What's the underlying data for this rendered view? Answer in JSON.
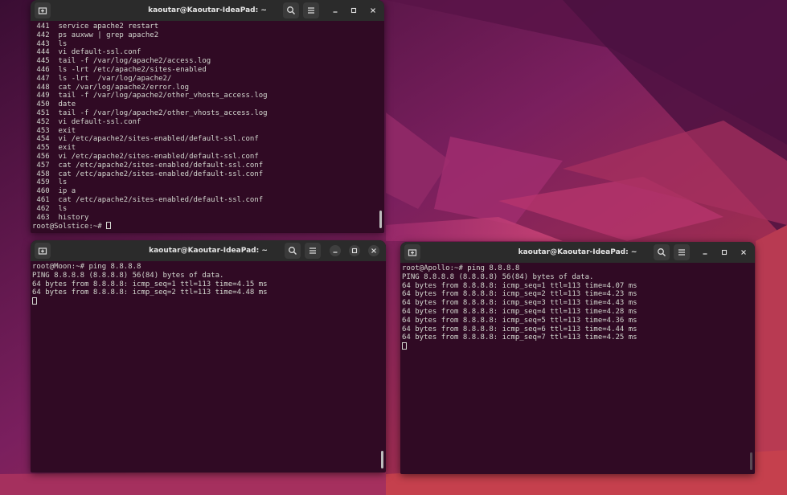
{
  "desktop": {
    "wallpaper": "ubuntu-jammy-jellyfish"
  },
  "windows": [
    {
      "id": "top-left",
      "title": "kaoutar@Kaoutar-IdeaPad: ~",
      "lines": [
        " 441  service apache2 restart",
        " 442  ps auxww | grep apache2",
        " 443  ls",
        " 444  vi default-ssl.conf",
        " 445  tail -f /var/log/apache2/access.log",
        " 446  ls -lrt /etc/apache2/sites-enabled",
        " 447  ls -lrt  /var/log/apache2/",
        " 448  cat /var/log/apache2/error.log",
        " 449  tail -f /var/log/apache2/other_vhosts_access.log",
        " 450  date",
        " 451  tail -f /var/log/apache2/other_vhosts_access.log",
        " 452  vi default-ssl.conf",
        " 453  exit",
        " 454  vi /etc/apache2/sites-enabled/default-ssl.conf",
        " 455  exit",
        " 456  vi /etc/apache2/sites-enabled/default-ssl.conf",
        " 457  cat /etc/apache2/sites-enabled/default-ssl.conf",
        " 458  cat /etc/apache2/sites-enabled/default-ssl.conf",
        " 459  ls",
        " 460  ip a",
        " 461  cat /etc/apache2/sites-enabled/default-ssl.conf",
        " 462  ls",
        " 463  history"
      ],
      "prompt": "root@Solstice:~# "
    },
    {
      "id": "bottom-left",
      "title": "kaoutar@Kaoutar-IdeaPad: ~",
      "lines": [
        "root@Moon:~# ping 8.8.8.8",
        "PING 8.8.8.8 (8.8.8.8) 56(84) bytes of data.",
        "64 bytes from 8.8.8.8: icmp_seq=1 ttl=113 time=4.15 ms",
        "64 bytes from 8.8.8.8: icmp_seq=2 ttl=113 time=4.48 ms"
      ]
    },
    {
      "id": "right",
      "title": "kaoutar@Kaoutar-IdeaPad: ~",
      "lines": [
        "root@Apollo:~# ping 8.8.8.8",
        "PING 8.8.8.8 (8.8.8.8) 56(84) bytes of data.",
        "64 bytes from 8.8.8.8: icmp_seq=1 ttl=113 time=4.07 ms",
        "64 bytes from 8.8.8.8: icmp_seq=2 ttl=113 time=4.23 ms",
        "64 bytes from 8.8.8.8: icmp_seq=3 ttl=113 time=4.43 ms",
        "64 bytes from 8.8.8.8: icmp_seq=4 ttl=113 time=4.28 ms",
        "64 bytes from 8.8.8.8: icmp_seq=5 ttl=113 time=4.36 ms",
        "64 bytes from 8.8.8.8: icmp_seq=6 ttl=113 time=4.44 ms",
        "64 bytes from 8.8.8.8: icmp_seq=7 ttl=113 time=4.25 ms"
      ]
    }
  ],
  "colors": {
    "terminal_bg": "#300a24",
    "terminal_fg": "#d3d7cf",
    "titlebar_bg": "#2b2b2b"
  }
}
